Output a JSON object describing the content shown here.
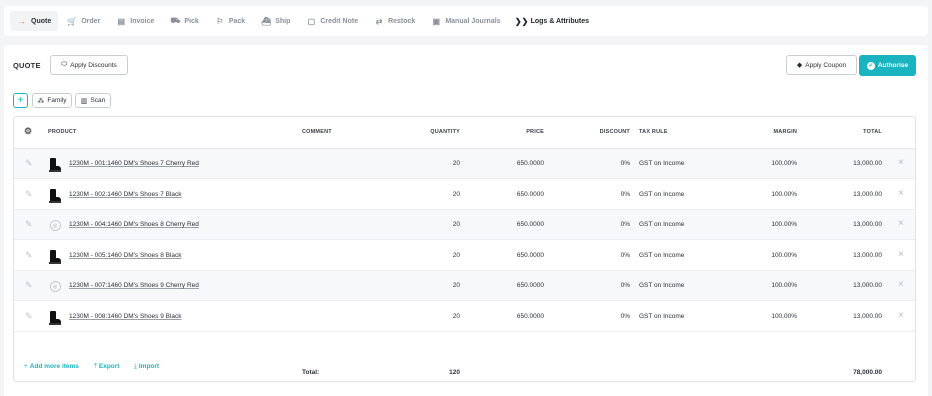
{
  "tabs": [
    {
      "label": "Quote",
      "icon": "arrow-right-icon",
      "glyph": "→",
      "active": true
    },
    {
      "label": "Order",
      "icon": "cart-icon",
      "glyph": "🛒"
    },
    {
      "label": "Invoice",
      "icon": "invoice-icon",
      "glyph": "▤"
    },
    {
      "label": "Pick",
      "icon": "pick-icon",
      "glyph": "⛟"
    },
    {
      "label": "Pack",
      "icon": "pack-icon",
      "glyph": "⚐"
    },
    {
      "label": "Ship",
      "icon": "ship-icon",
      "glyph": "⛴"
    },
    {
      "label": "Credit Note",
      "icon": "credit-note-icon",
      "glyph": "▢"
    },
    {
      "label": "Restock",
      "icon": "restock-icon",
      "glyph": "⇄"
    },
    {
      "label": "Manual Journals",
      "icon": "journals-icon",
      "glyph": "▣"
    },
    {
      "label": "Logs & Attributes",
      "icon": "logs-icon",
      "glyph": "❯❯",
      "dark": true
    }
  ],
  "panel": {
    "title": "QUOTE",
    "apply_discounts": "Apply Discounts",
    "apply_coupon": "Apply Coupon",
    "authorise": "Authorise",
    "add_glyph": "+",
    "family": "Family",
    "scan": "Scan"
  },
  "table": {
    "headers": {
      "product": "PRODUCT",
      "comment": "COMMENT",
      "quantity": "QUANTITY",
      "price": "PRICE",
      "discount": "DISCOUNT",
      "tax_rule": "TAX RULE",
      "margin": "MARGIN",
      "total": "TOTAL"
    },
    "rows": [
      {
        "product": "1230M - 001:1460 DM's Shoes 7 Cherry Red",
        "image": "boot",
        "quantity": "20",
        "price": "650.0000",
        "discount": "0%",
        "tax_rule": "GST on Income",
        "margin": "100.00%",
        "total": "13,000.00"
      },
      {
        "product": "1230M - 002:1460 DM's Shoes 7 Black",
        "image": "boot",
        "quantity": "20",
        "price": "650.0000",
        "discount": "0%",
        "tax_rule": "GST on Income",
        "margin": "100.00%",
        "total": "13,000.00"
      },
      {
        "product": "1230M - 004:1460 DM's Shoes 8 Cherry Red",
        "image": "none",
        "quantity": "20",
        "price": "650.0000",
        "discount": "0%",
        "tax_rule": "GST on Income",
        "margin": "100.00%",
        "total": "13,000.00"
      },
      {
        "product": "1230M - 005:1460 DM's Shoes 8 Black",
        "image": "boot",
        "quantity": "20",
        "price": "650.0000",
        "discount": "0%",
        "tax_rule": "GST on Income",
        "margin": "100.00%",
        "total": "13,000.00"
      },
      {
        "product": "1230M - 007:1460 DM's Shoes 9 Cherry Red",
        "image": "none",
        "quantity": "20",
        "price": "650.0000",
        "discount": "0%",
        "tax_rule": "GST on Income",
        "margin": "100.00%",
        "total": "13,000.00"
      },
      {
        "product": "1230M - 008:1460 DM's Shoes 9 Black",
        "image": "boot",
        "quantity": "20",
        "price": "650.0000",
        "discount": "0%",
        "tax_rule": "GST on Income",
        "margin": "100.00%",
        "total": "13,000.00"
      }
    ],
    "totals": {
      "label": "Total:",
      "quantity": "120",
      "total": "78,000.00"
    }
  },
  "actions": {
    "add_more": "Add more items",
    "export": "Export",
    "import": "Import"
  },
  "colors": {
    "accent": "#19b4c0",
    "active_tab_icon": "#e08a1e"
  }
}
